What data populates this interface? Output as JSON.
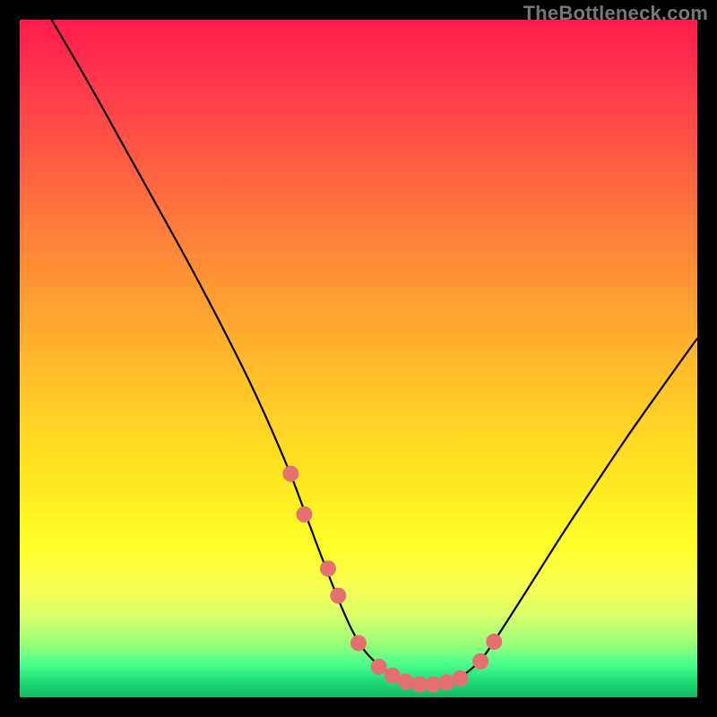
{
  "watermark": "TheBottleneck.com",
  "colors": {
    "background": "#000000",
    "curve": "#000000",
    "marker": "#e4716f",
    "gradient_top": "#ff1a4d",
    "gradient_bottom": "#16b85e"
  },
  "chart_data": {
    "type": "line",
    "title": "",
    "xlabel": "",
    "ylabel": "",
    "xlim": [
      0,
      100
    ],
    "ylim": [
      0,
      100
    ],
    "x": [
      0,
      5,
      10,
      15,
      20,
      25,
      30,
      35,
      40,
      42,
      45,
      48,
      50,
      52,
      55,
      57,
      60,
      62,
      65,
      68,
      70,
      75,
      80,
      85,
      90,
      95,
      100
    ],
    "values": [
      108,
      99.5,
      91,
      82,
      73,
      64,
      54.5,
      44.5,
      33,
      27.5,
      19.5,
      12,
      8,
      5.5,
      3.2,
      2.3,
      1.8,
      1.9,
      2.8,
      5.3,
      8.2,
      16,
      24,
      31.5,
      39,
      46,
      53
    ],
    "markers": {
      "x": [
        40,
        42,
        45.5,
        47,
        50,
        53,
        55,
        57,
        59,
        61,
        63,
        65,
        68,
        70
      ],
      "y": [
        33,
        27,
        19,
        15,
        8,
        4.5,
        3.2,
        2.3,
        1.9,
        1.9,
        2.2,
        2.8,
        5.3,
        8.2
      ]
    }
  }
}
